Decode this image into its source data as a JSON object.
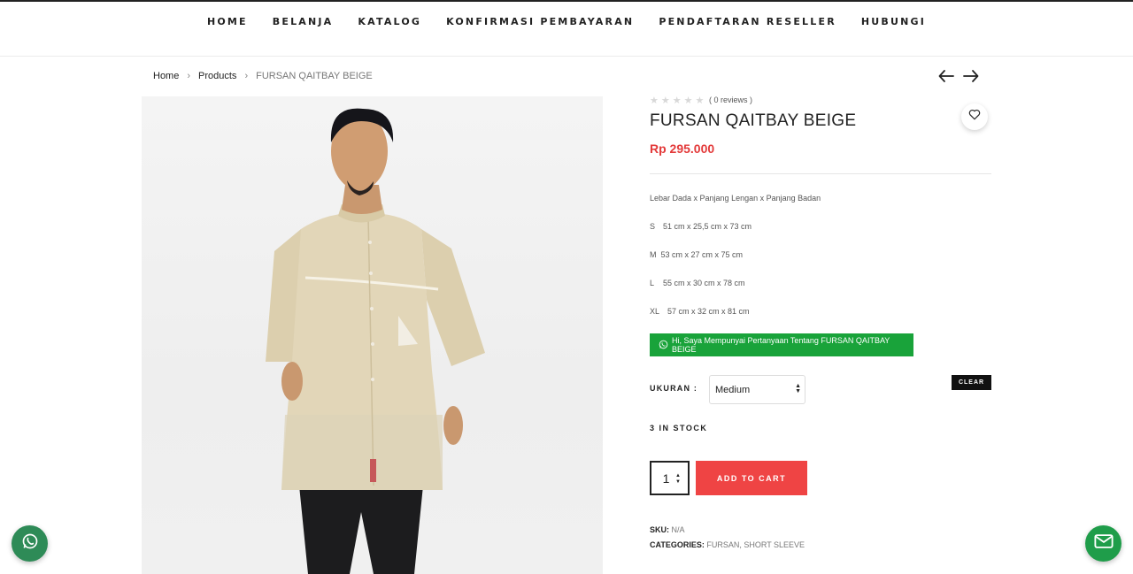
{
  "nav": {
    "items": [
      "HOME",
      "BELANJA",
      "KATALOG",
      "KONFIRMASI PEMBAYARAN",
      "PENDAFTARAN RESELLER",
      "HUBUNGI"
    ]
  },
  "breadcrumb": {
    "home": "Home",
    "products": "Products",
    "current": "FURSAN QAITBAY BEIGE"
  },
  "product": {
    "rating": 0,
    "reviews_text": "( 0 reviews )",
    "title": "FURSAN QAITBAY BEIGE",
    "price": "Rp 295.000",
    "description": {
      "header": "Lebar Dada x Panjang Lengan x Panjang Badan",
      "sizes": [
        {
          "size": "S",
          "dims": "51 cm x 25,5 cm x 73 cm"
        },
        {
          "size": "M",
          "dims": "53 cm x 27 cm x 75 cm"
        },
        {
          "size": "L",
          "dims": "55 cm x 30 cm x 78 cm"
        },
        {
          "size": "XL",
          "dims": "57 cm x 32 cm x 81 cm"
        }
      ]
    },
    "whatsapp_button": "Hi, Saya Mempunyai Pertanyaan Tentang FURSAN QAITBAY BEIGE",
    "size_label": "UKURAN :",
    "size_selected": "Medium",
    "clear_label": "CLEAR",
    "stock": "3 IN STOCK",
    "quantity": "1",
    "add_to_cart": "ADD TO CART",
    "sku_label": "SKU:",
    "sku_value": "N/A",
    "categories_label": "CATEGORIES:",
    "categories_value": "FURSAN, SHORT SLEEVE"
  },
  "colors": {
    "price": "#e33a3a",
    "add_to_cart": "#ef4444",
    "whatsapp": "#19a33a",
    "float_whatsapp": "#2e8b57",
    "float_mail": "#1f9d4a"
  },
  "icons": {
    "prev": "arrow-left-icon",
    "next": "arrow-right-icon",
    "wishlist": "heart-icon",
    "whatsapp": "whatsapp-icon",
    "mail": "mail-icon"
  }
}
